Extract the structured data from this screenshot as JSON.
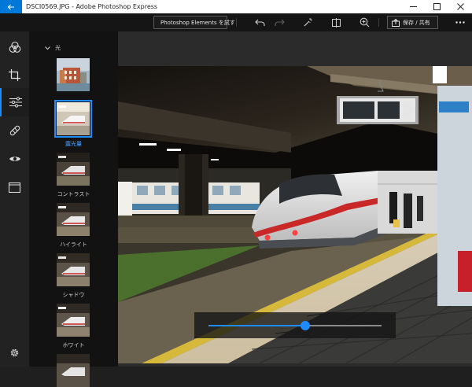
{
  "window": {
    "title": "DSCI0569.JPG - Adobe Photoshop Express"
  },
  "toolbar": {
    "try_label": "Photoshop Elements を試す",
    "save_label": "保存 / 共有",
    "icons": [
      "undo-icon",
      "redo-icon",
      "magic-wand-icon",
      "compare-icon",
      "zoom-in-icon",
      "more-icon"
    ]
  },
  "rail": {
    "items": [
      {
        "name": "filters-icon"
      },
      {
        "name": "crop-icon"
      },
      {
        "name": "adjust-icon",
        "active": true
      },
      {
        "name": "healing-icon"
      },
      {
        "name": "red-eye-icon"
      },
      {
        "name": "border-icon"
      }
    ],
    "settings_icon": "gear-icon"
  },
  "panel": {
    "section_label": "光",
    "items": [
      {
        "label": ""
      },
      {
        "label": "露光量",
        "selected": true
      },
      {
        "label": "コントラスト"
      },
      {
        "label": "ハイライト"
      },
      {
        "label": "シャドウ"
      },
      {
        "label": "ホワイト"
      },
      {
        "label": ""
      }
    ]
  },
  "slider": {
    "value_fraction": 0.56
  },
  "colors": {
    "accent": "#1e8cff",
    "titlebar_back": "#0078d7"
  }
}
